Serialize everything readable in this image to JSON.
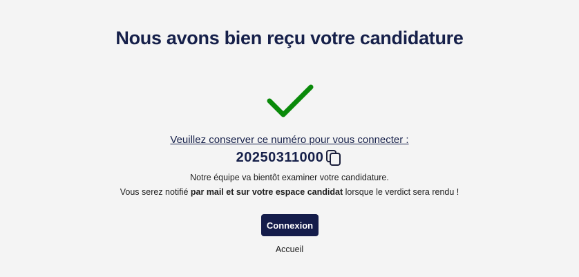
{
  "header": {
    "title": "Nous avons bien reçu votre candidature"
  },
  "status": {
    "icon": "checkmark-icon",
    "color": "#0a8a0a"
  },
  "reference": {
    "label": "Veuillez conserver ce numéro pour vous connecter :",
    "number": "20250311000",
    "copy_icon": "copy-icon"
  },
  "message": {
    "line1": "Notre équipe va bientôt examiner votre candidature.",
    "line2_before": "Vous serez notifié ",
    "line2_bold": "par mail et sur votre espace candidat",
    "line2_after": " lorsque le verdict sera rendu !"
  },
  "actions": {
    "login_label": "Connexion",
    "home_label": "Accueil",
    "button_color": "#141c4a"
  }
}
